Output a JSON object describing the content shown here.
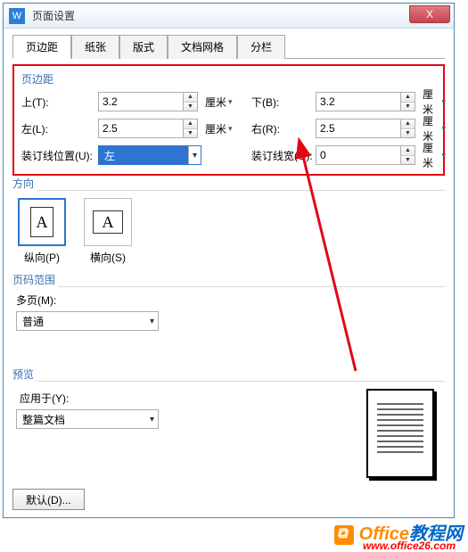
{
  "window": {
    "title": "页面设置",
    "close": "X"
  },
  "tabs": [
    "页边距",
    "纸张",
    "版式",
    "文档网格",
    "分栏"
  ],
  "active_tab": 0,
  "margins": {
    "legend": "页边距",
    "top_label": "上(T):",
    "top_value": "3.2",
    "top_unit": "厘米",
    "bottom_label": "下(B):",
    "bottom_value": "3.2",
    "bottom_unit": "厘米",
    "left_label": "左(L):",
    "left_value": "2.5",
    "left_unit": "厘米",
    "right_label": "右(R):",
    "right_value": "2.5",
    "right_unit": "厘米",
    "gutter_pos_label": "装订线位置(U):",
    "gutter_pos_value": "左",
    "gutter_width_label": "装订线宽(G):",
    "gutter_width_value": "0",
    "gutter_width_unit": "厘米"
  },
  "orientation": {
    "legend": "方向",
    "portrait_label": "纵向(P)",
    "landscape_label": "横向(S)",
    "glyph": "A"
  },
  "page_range": {
    "legend": "页码范围",
    "multi_label": "多页(M):",
    "multi_value": "普通"
  },
  "preview": {
    "legend": "预览",
    "apply_label": "应用于(Y):",
    "apply_value": "整篇文档"
  },
  "footer": {
    "default_btn": "默认(D)..."
  },
  "watermark": {
    "brand1": "Office",
    "brand2": "教程网",
    "url": "www.office26.com"
  }
}
